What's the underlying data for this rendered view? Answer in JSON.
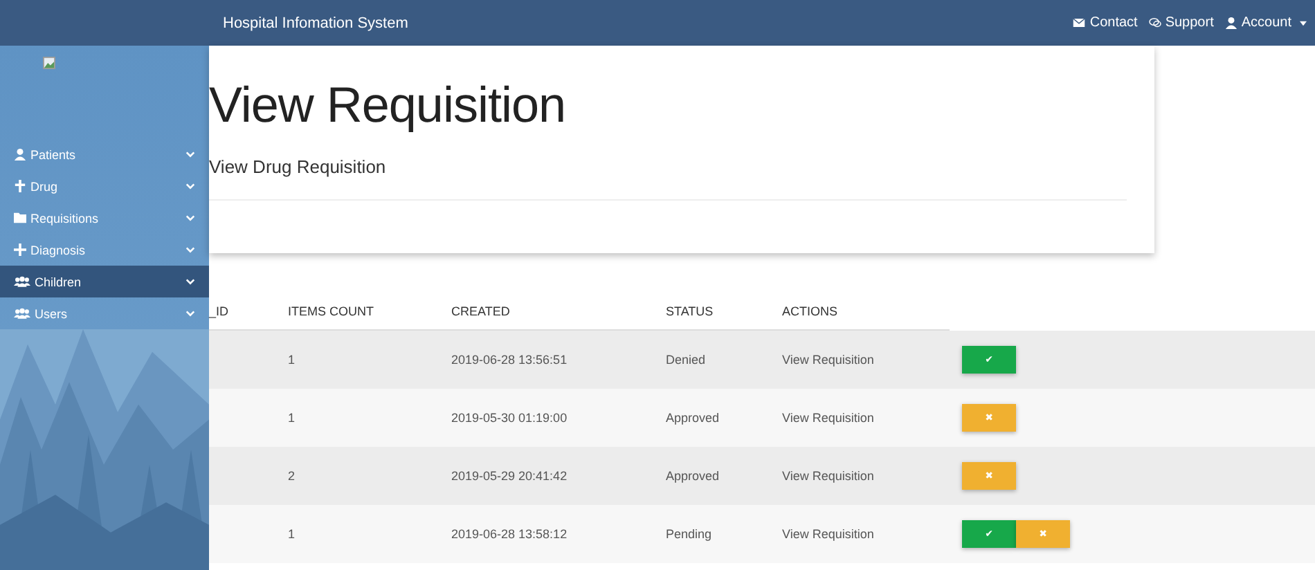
{
  "topbar": {
    "title": "Hospital Infomation System",
    "links": [
      {
        "label": "Contact",
        "kind": "envelope",
        "dropdown": false
      },
      {
        "label": "Support",
        "kind": "chat",
        "dropdown": false
      },
      {
        "label": "Account",
        "kind": "user",
        "dropdown": true
      }
    ]
  },
  "sidebar": {
    "items": [
      {
        "label": "Patients",
        "kind": "user",
        "selected": false
      },
      {
        "label": "Drug",
        "kind": "cross",
        "selected": false
      },
      {
        "label": "Requisitions",
        "kind": "folder",
        "selected": false
      },
      {
        "label": "Diagnosis",
        "kind": "plus",
        "selected": false
      },
      {
        "label": "Children",
        "kind": "users",
        "selected": true
      },
      {
        "label": "Users",
        "kind": "users",
        "selected": false
      }
    ]
  },
  "header": {
    "title": "View Requisition",
    "subtitle": "View Drug Requisition"
  },
  "table": {
    "columns": [
      "_ID",
      "ITEMS COUNT",
      "CREATED",
      "STATUS",
      "ACTIONS"
    ],
    "rows": [
      {
        "items_count": "1",
        "created": "2019-06-28 13:56:51",
        "status": "Denied",
        "action": "View Requisition",
        "buttons": [
          {
            "kind": "approve",
            "label": "✔"
          }
        ]
      },
      {
        "items_count": "1",
        "created": "2019-05-30 01:19:00",
        "status": "Approved",
        "action": "View Requisition",
        "buttons": [
          {
            "kind": "reject",
            "label": "✖"
          }
        ]
      },
      {
        "items_count": "2",
        "created": "2019-05-29 20:41:42",
        "status": "Approved",
        "action": "View Requisition",
        "buttons": [
          {
            "kind": "reject",
            "label": "✖"
          }
        ]
      },
      {
        "items_count": "1",
        "created": "2019-06-28 13:58:12",
        "status": "Pending",
        "action": "View Requisition",
        "buttons": [
          {
            "kind": "approve",
            "label": "✔"
          },
          {
            "kind": "reject",
            "label": "✖"
          }
        ]
      }
    ]
  }
}
